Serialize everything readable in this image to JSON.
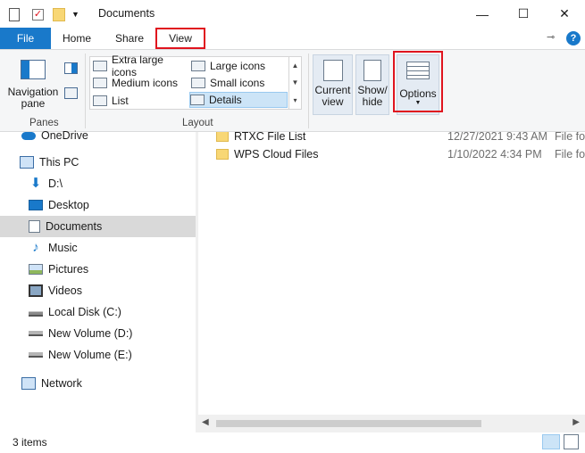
{
  "window": {
    "title": "Documents",
    "controls": {
      "minimize": "—",
      "maximize": "☐",
      "close": "✕"
    }
  },
  "tabs": [
    "File",
    "Home",
    "Share",
    "View"
  ],
  "ribbon": {
    "panes": {
      "button_label": "Navigation pane",
      "group_label": "Panes"
    },
    "layout": {
      "group_label": "Layout",
      "items": [
        "Extra large icons",
        "Large icons",
        "Medium icons",
        "Small icons",
        "List",
        "Details"
      ],
      "selected": "Details"
    },
    "current_view": "Current view",
    "show_hide": "Show/ hide",
    "options": "Options"
  },
  "nav": {
    "items": [
      "OneDrive",
      "This PC",
      "D:\\",
      "Desktop",
      "Documents",
      "Music",
      "Pictures",
      "Videos",
      "Local Disk (C:)",
      "New Volume (D:)",
      "New Volume (E:)",
      "Network"
    ],
    "selected": "Documents"
  },
  "files": [
    {
      "name": "RTXC File List",
      "date": "12/27/2021 9:43 AM",
      "type": "File fo"
    },
    {
      "name": "WPS Cloud Files",
      "date": "1/10/2022 4:34 PM",
      "type": "File fo"
    }
  ],
  "status": {
    "count": "3 items"
  },
  "colors": {
    "accent": "#1979ca",
    "highlight": "#e0141e",
    "selected_nav": "#d9d9d9"
  }
}
